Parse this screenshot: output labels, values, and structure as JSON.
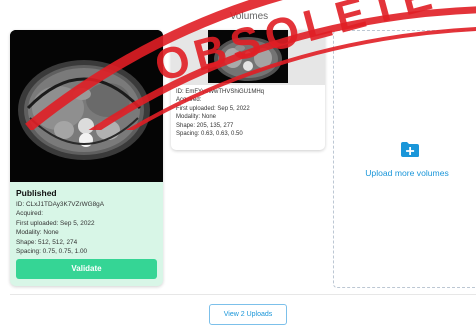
{
  "watermark": {
    "text": "OBSOLETE",
    "color": "#e01e25"
  },
  "section": {
    "title": "Volumes"
  },
  "volumes": [
    {
      "status": "Published",
      "id_line": "ID: CLxJ1TDAy3K7VZrWG8gA",
      "acquired_line": "Acquired:",
      "uploaded_line": "First uploaded: Sep 5, 2022",
      "modality_line": "Modality: None",
      "shape_line": "Shape: 512, 512, 274",
      "spacing_line": "Spacing: 0.75, 0.75, 1.00",
      "validate_label": "Validate",
      "card_color": "#d8f6e7",
      "button_color": "#35d595"
    },
    {
      "id_line": "ID: EmFYyeWwTHVShiGU1MHq",
      "acquired_line": "Acquired:",
      "uploaded_line": "First uploaded: Sep 5, 2022",
      "modality_line": "Modality: None",
      "shape_line": "Shape: 205, 135, 277",
      "spacing_line": "Spacing: 0.63, 0.63, 0.50"
    }
  ],
  "upload": {
    "label": "Upload more volumes",
    "icon": "folder-plus-icon",
    "accent": "#1a96d9"
  },
  "footer": {
    "view_uploads_label": "View 2 Uploads"
  }
}
